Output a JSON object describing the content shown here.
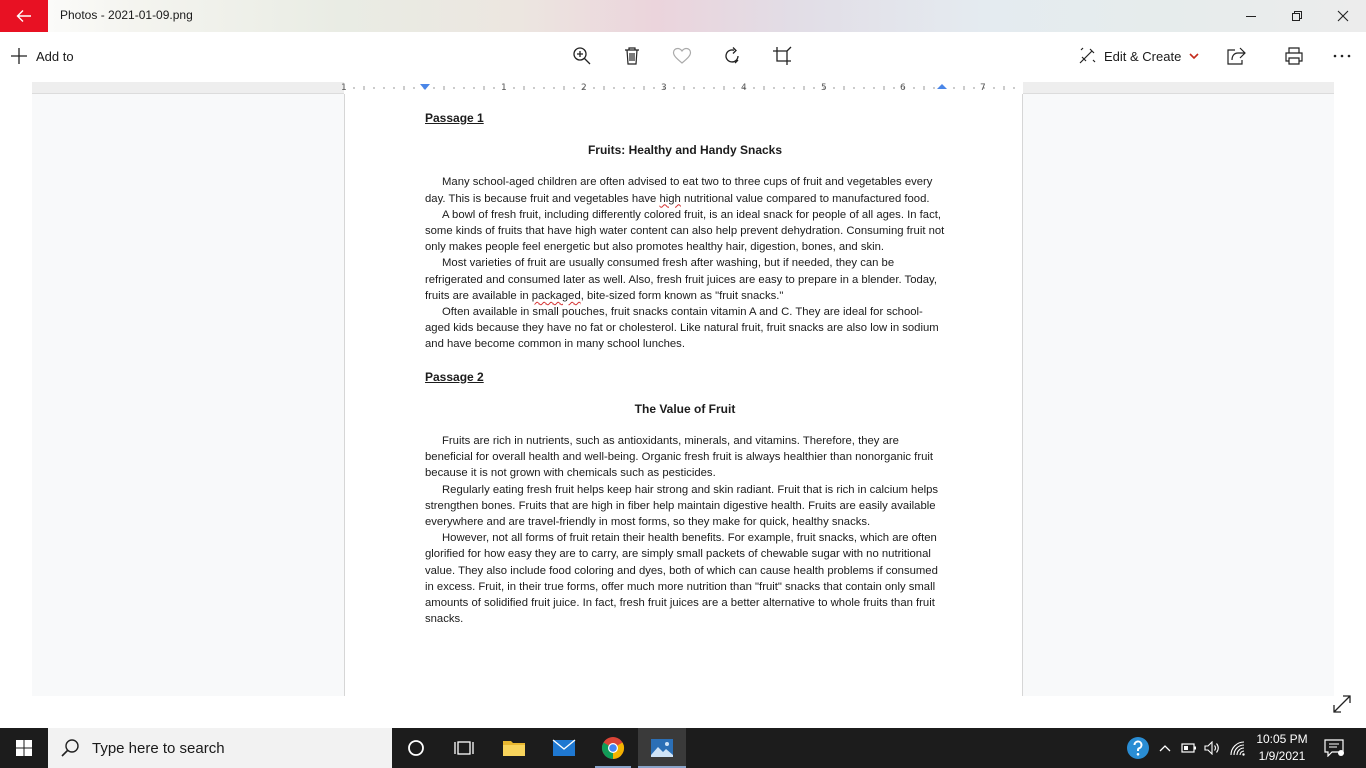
{
  "window": {
    "title": "Photos - 2021-01-09.png"
  },
  "toolbar": {
    "add_to_label": "Add to",
    "edit_create_label": "Edit & Create",
    "icons": [
      "zoom-in-icon",
      "delete-icon",
      "favorite-icon",
      "rotate-icon",
      "crop-icon",
      "share-icon",
      "print-icon",
      "more-icon"
    ]
  },
  "ruler": {
    "numbers": [
      "1",
      "1",
      "2",
      "3",
      "4",
      "5",
      "6",
      "7"
    ]
  },
  "document": {
    "passage1": {
      "label": "Passage 1",
      "title": "Fruits: Healthy and Handy Snacks",
      "p1_a": "Many school-aged children are often advised to eat two to three cups of fruit and vegetables every day. This is because fruit and vegetables have ",
      "p1_spell": "high",
      "p1_b": " nutritional value compared to manufactured food.",
      "p2": "A bowl of fresh fruit, including differently colored fruit, is an ideal snack for people of all ages. In fact, some kinds of fruits that have high water content can also help prevent dehydration. Consuming fruit not only makes people feel energetic but also promotes healthy hair, digestion, bones, and skin.",
      "p3_a": "Most varieties of fruit are usually consumed fresh after washing, but if needed, they can be refrigerated and consumed later as well. Also, fresh fruit juices are easy to prepare in a blender. Today, fruits are available in ",
      "p3_spell": "packaged",
      "p3_b": ", bite-sized form known as \"fruit snacks.\"",
      "p4": "Often available in small pouches, fruit snacks contain vitamin A and C. They are ideal for school-aged kids because they have no fat or cholesterol. Like natural fruit, fruit snacks are also low in sodium and have become common in many school lunches."
    },
    "passage2": {
      "label": "Passage 2",
      "title": "The Value of Fruit",
      "p1": "Fruits are rich in nutrients, such as antioxidants, minerals, and vitamins. Therefore, they are beneficial for overall health and well-being. Organic fresh fruit is always healthier than nonorganic fruit because it is not grown with chemicals such as pesticides.",
      "p2": "Regularly eating fresh fruit helps keep hair strong and skin radiant. Fruit that is rich in calcium helps strengthen bones. Fruits that are high in fiber help maintain digestive health. Fruits are easily available everywhere and are travel-friendly in most forms, so they make for quick, healthy snacks.",
      "p3": "However, not all forms of fruit retain their health benefits. For example, fruit snacks, which are often glorified for how easy they are to carry, are simply small packets of chewable sugar with no nutritional value. They also include food coloring and dyes, both of which can cause health problems if consumed in excess. Fruit, in their true forms, offer much more nutrition than \"fruit\" snacks that contain only small amounts of solidified fruit juice. In fact, fresh fruit juices are a better alternative to whole fruits than fruit snacks."
    }
  },
  "taskbar": {
    "search_placeholder": "Type here to search",
    "time": "10:05 PM",
    "date": "1/9/2021"
  },
  "colors": {
    "back_button": "#e81123",
    "edit_chevron": "#c42b1c",
    "spellcheck": "#d32f2f"
  }
}
